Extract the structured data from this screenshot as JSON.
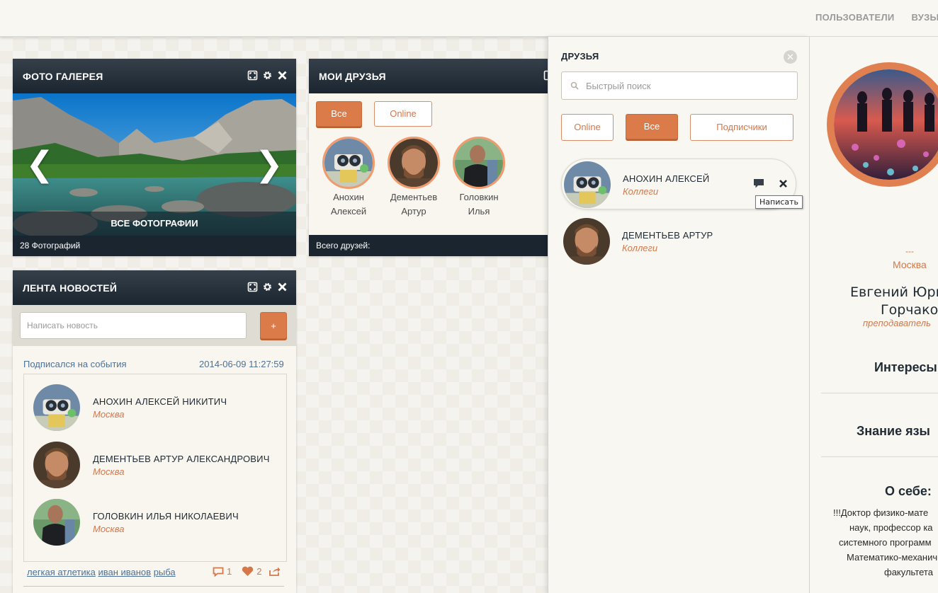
{
  "topnav": {
    "items": [
      "ПОЛЬЗОВАТЕЛИ",
      "ВУЗЫ"
    ]
  },
  "gallery": {
    "title": "ФОТО ГАЛЕРЕЯ",
    "all_photos_label": "ВСЕ ФОТОГРАФИИ",
    "count_label": "28 Фотографий",
    "prev_glyph": "❮",
    "next_glyph": "❯"
  },
  "my_friends": {
    "title": "МОИ ДРУЗЬЯ",
    "filter_all": "Все",
    "filter_online": "Online",
    "friends": [
      {
        "first": "Анохин",
        "second": "Алексей"
      },
      {
        "first": "Дементьев",
        "second": "Артур"
      },
      {
        "first": "Головкин",
        "second": "Илья"
      }
    ],
    "total_label": "Всего друзей:"
  },
  "news": {
    "title": "ЛЕНТА НОВОСТЕЙ",
    "input_placeholder": "Написать новость",
    "add_label": "+",
    "event_text": "Подписался на события",
    "event_time": "2014-06-09 11:27:59",
    "people": [
      {
        "name": "АНОХИН АЛЕКСЕЙ НИКИТИЧ",
        "city": "Москва"
      },
      {
        "name": "ДЕМЕНТЬЕВ АРТУР АЛЕКСАНДРОВИЧ",
        "city": "Москва"
      },
      {
        "name": "ГОЛОВКИН ИЛЬЯ НИКОЛАЕВИЧ",
        "city": "Москва"
      }
    ],
    "tags": [
      "легкая атлетика",
      "иван иванов",
      "рыба"
    ],
    "comments_count": "1",
    "likes_count": "2"
  },
  "friends_panel": {
    "title": "ДРУЗЬЯ",
    "close_glyph": "✕",
    "search_placeholder": "Быстрый поиск",
    "tabs": {
      "online": "Online",
      "all": "Все",
      "subscribers": "Подписчики"
    },
    "friends": [
      {
        "name": "АНОХИН АЛЕКСЕЙ",
        "group": "Коллеги"
      },
      {
        "name": "ДЕМЕНТЬЕВ АРТУР",
        "group": "Коллеги"
      }
    ],
    "tooltip": "Написать"
  },
  "profile": {
    "dashes": "---",
    "city": "Москва",
    "name_line1": "Евгений Юрь",
    "name_line2": "Горчаков",
    "role": "преподаватель",
    "interests_heading": "Интересы",
    "languages_heading": "Знание язы",
    "about_heading": "О себе:",
    "about_lines": [
      "!!!Доктор физико-мате",
      "наук, профессор ка",
      "системного программ",
      "Математико-механич",
      "факультета"
    ]
  },
  "colors": {
    "accent": "#dc7b4a",
    "header_dark": "#1b252f",
    "link": "#4e7196"
  }
}
